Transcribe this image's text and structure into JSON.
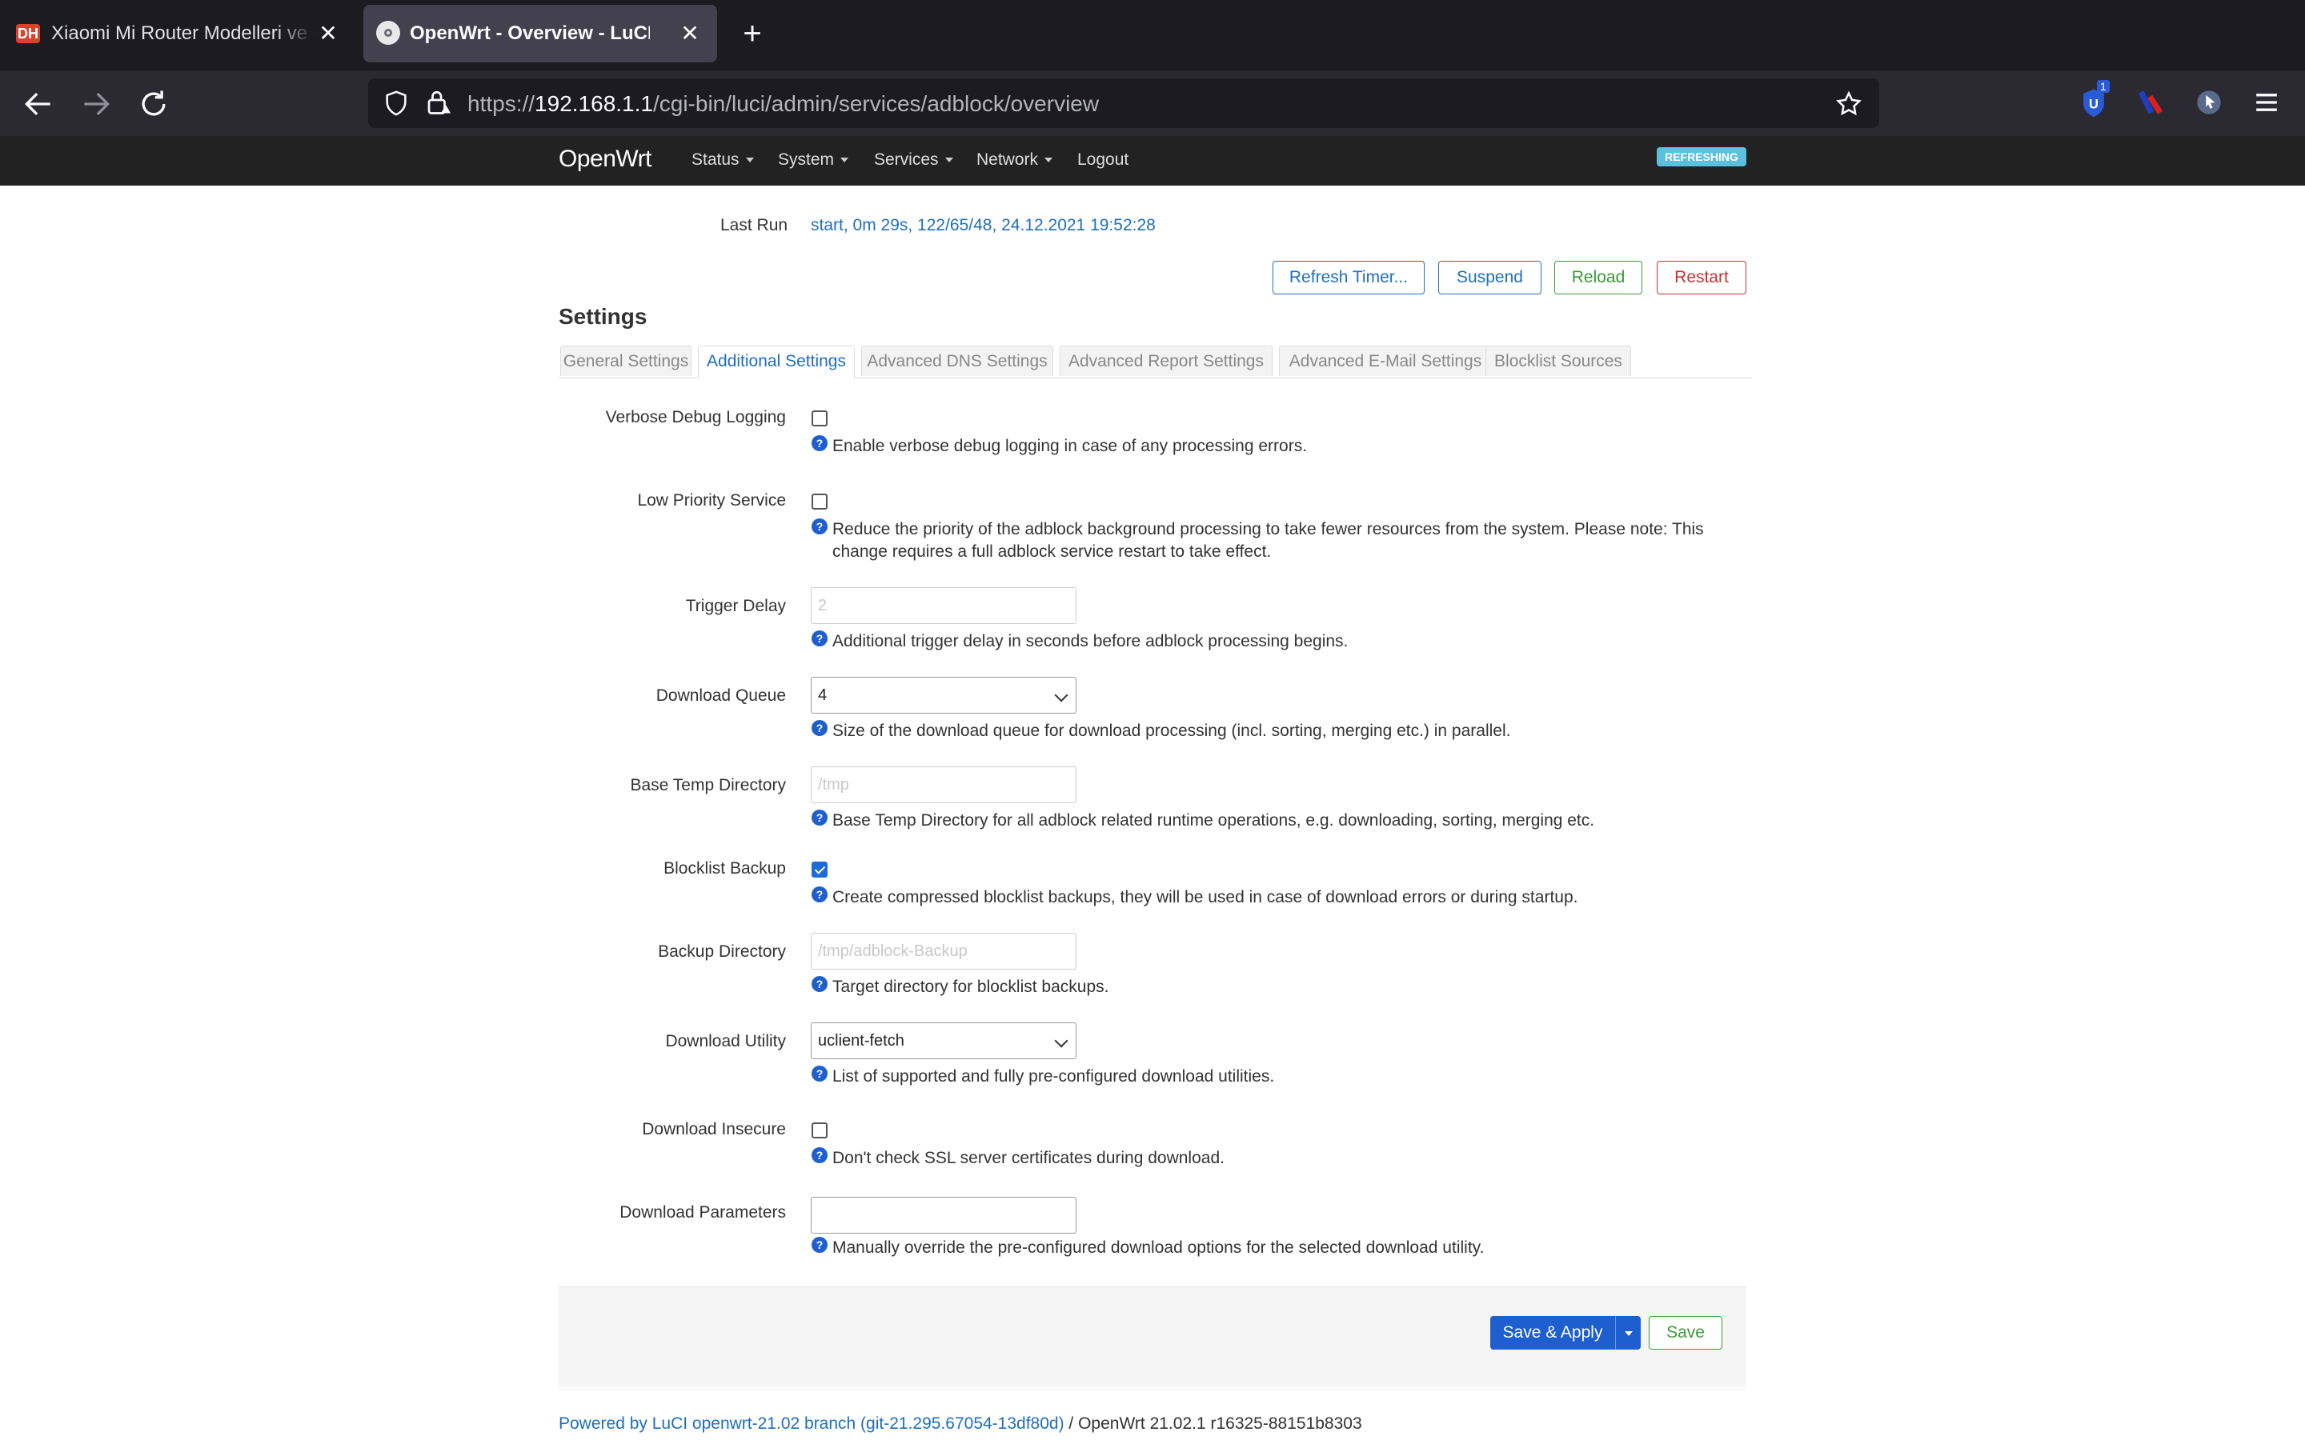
{
  "browser": {
    "tabs": [
      {
        "title": "Xiaomi Mi Router Modelleri ve Op",
        "favicon": "DH",
        "active": false
      },
      {
        "title": "OpenWrt - Overview - LuCI",
        "active": true
      }
    ],
    "url_scheme": "https://",
    "url_host": "192.168.1.1",
    "url_path": "/cgi-bin/luci/admin/services/adblock/overview",
    "extension_badge": "1"
  },
  "luci": {
    "brand": "OpenWrt",
    "menu": [
      "Status",
      "System",
      "Services",
      "Network",
      "Logout"
    ],
    "refreshing_badge": "REFRESHING"
  },
  "status": {
    "last_run_label": "Last Run",
    "last_run_value": "start, 0m 29s, 122/65/48, 24.12.2021 19:52:28"
  },
  "actions": {
    "refresh_timer": "Refresh Timer...",
    "suspend": "Suspend",
    "reload": "Reload",
    "restart": "Restart"
  },
  "settings": {
    "title": "Settings",
    "tabs": [
      "General Settings",
      "Additional Settings",
      "Advanced DNS Settings",
      "Advanced Report Settings",
      "Advanced E-Mail Settings",
      "Blocklist Sources"
    ],
    "active_tab": "Additional Settings",
    "fields": {
      "verbose": {
        "label": "Verbose Debug Logging",
        "checked": false,
        "help": "Enable verbose debug logging in case of any processing errors."
      },
      "lowprio": {
        "label": "Low Priority Service",
        "checked": false,
        "help": "Reduce the priority of the adblock background processing to take fewer resources from the system. Please note: This change requires a full adblock service restart to take effect."
      },
      "trigger": {
        "label": "Trigger Delay",
        "placeholder": "2",
        "help": "Additional trigger delay in seconds before adblock processing begins."
      },
      "queue": {
        "label": "Download Queue",
        "value": "4",
        "help": "Size of the download queue for download processing (incl. sorting, merging etc.) in parallel."
      },
      "tempdir": {
        "label": "Base Temp Directory",
        "placeholder": "/tmp",
        "help": "Base Temp Directory for all adblock related runtime operations, e.g. downloading, sorting, merging etc."
      },
      "backup": {
        "label": "Blocklist Backup",
        "checked": true,
        "help": "Create compressed blocklist backups, they will be used in case of download errors or during startup."
      },
      "backupdir": {
        "label": "Backup Directory",
        "placeholder": "/tmp/adblock-Backup",
        "help": "Target directory for blocklist backups."
      },
      "utility": {
        "label": "Download Utility",
        "value": "uclient-fetch",
        "help": "List of supported and fully pre-configured download utilities."
      },
      "insecure": {
        "label": "Download Insecure",
        "checked": false,
        "help": "Don't check SSL server certificates during download."
      },
      "params": {
        "label": "Download Parameters",
        "value": "",
        "help": "Manually override the pre-configured download options for the selected download utility."
      }
    }
  },
  "footer": {
    "save_apply": "Save & Apply",
    "save": "Save",
    "powered_link": "Powered by LuCI openwrt-21.02 branch (git-21.295.67054-13df80d)",
    "powered_rest": " / OpenWrt 21.02.1 r16325-88151b8303"
  },
  "colors": {
    "link": "#1f6fbf",
    "primary": "#1d5fcf",
    "refreshing": "#5bc0de",
    "header": "#222222"
  }
}
